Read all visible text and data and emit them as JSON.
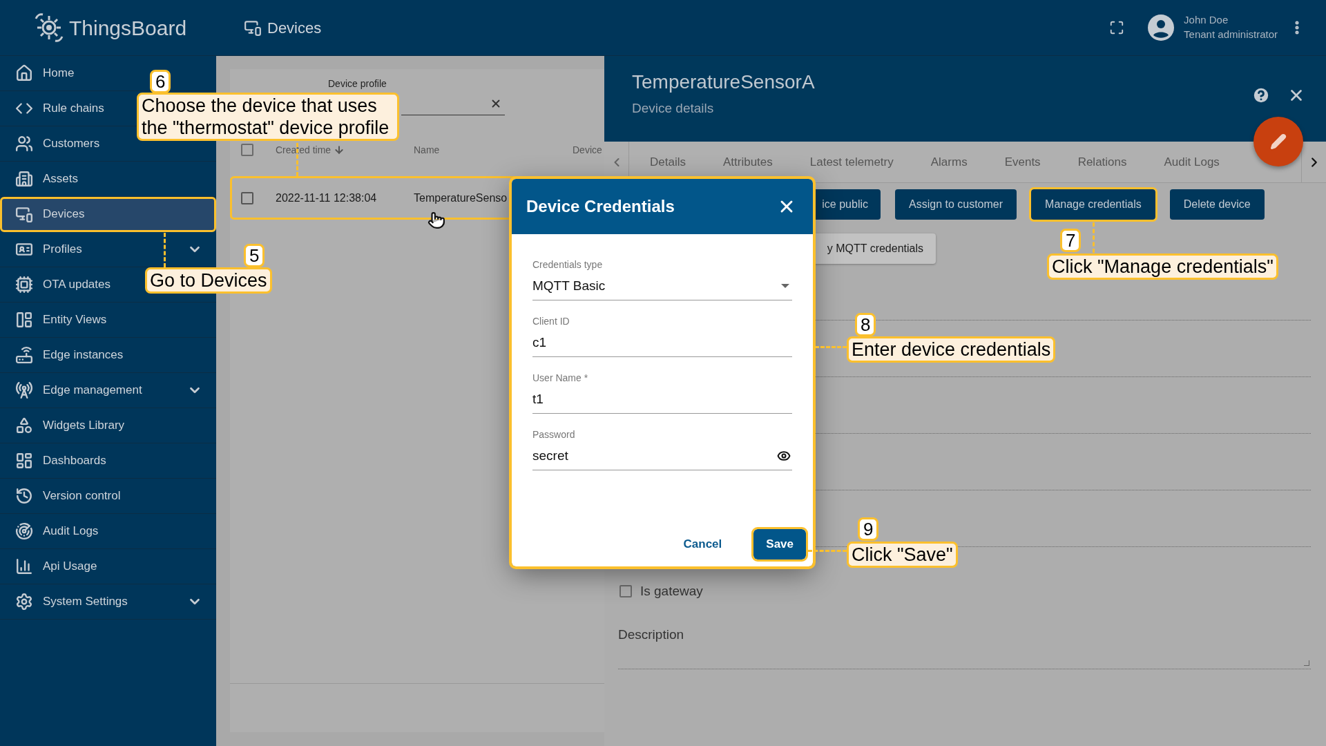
{
  "app": {
    "brand": "ThingsBoard"
  },
  "toolbar": {
    "title": "Devices",
    "user": {
      "name": "John Doe",
      "role": "Tenant administrator"
    }
  },
  "sidebar": {
    "items": [
      {
        "label": "Home",
        "selected": false,
        "highlighted": false,
        "expandable": false
      },
      {
        "label": "Rule chains",
        "selected": false,
        "highlighted": false,
        "expandable": false
      },
      {
        "label": "Customers",
        "selected": false,
        "highlighted": false,
        "expandable": false
      },
      {
        "label": "Assets",
        "selected": false,
        "highlighted": false,
        "expandable": false
      },
      {
        "label": "Devices",
        "selected": true,
        "highlighted": true,
        "expandable": false
      },
      {
        "label": "Profiles",
        "selected": false,
        "highlighted": false,
        "expandable": true
      },
      {
        "label": "OTA updates",
        "selected": false,
        "highlighted": false,
        "expandable": false
      },
      {
        "label": "Entity Views",
        "selected": false,
        "highlighted": false,
        "expandable": false
      },
      {
        "label": "Edge instances",
        "selected": false,
        "highlighted": false,
        "expandable": false
      },
      {
        "label": "Edge management",
        "selected": false,
        "highlighted": false,
        "expandable": true
      },
      {
        "label": "Widgets Library",
        "selected": false,
        "highlighted": false,
        "expandable": false
      },
      {
        "label": "Dashboards",
        "selected": false,
        "highlighted": false,
        "expandable": false
      },
      {
        "label": "Version control",
        "selected": false,
        "highlighted": false,
        "expandable": false
      },
      {
        "label": "Audit Logs",
        "selected": false,
        "highlighted": false,
        "expandable": false
      },
      {
        "label": "Api Usage",
        "selected": false,
        "highlighted": false,
        "expandable": false
      },
      {
        "label": "System Settings",
        "selected": false,
        "highlighted": false,
        "expandable": true
      }
    ]
  },
  "device_list": {
    "filter": {
      "label": "Device profile"
    },
    "all_selected": false,
    "columns": [
      {
        "label": "Created time",
        "sorted": true
      },
      {
        "label": "Name",
        "sorted": false
      },
      {
        "label": "Device",
        "sorted": false
      }
    ],
    "rows": [
      {
        "created_time": "2022-11-11 12:38:04",
        "name": "TemperatureSenso",
        "checked": false,
        "highlighted": true
      }
    ]
  },
  "details": {
    "title": "TemperatureSensorA",
    "subtitle": "Device details",
    "tabs": [
      "Details",
      "Attributes",
      "Latest telemetry",
      "Alarms",
      "Events",
      "Relations",
      "Audit Logs"
    ],
    "actions": [
      {
        "label": "ice public",
        "kind": "primary",
        "highlighted": false
      },
      {
        "label": "Assign to customer",
        "kind": "primary",
        "highlighted": false
      },
      {
        "label": "Manage credentials",
        "kind": "primary",
        "highlighted": true
      },
      {
        "label": "Delete device",
        "kind": "primary",
        "highlighted": false
      },
      {
        "label": "y MQTT credentials",
        "kind": "secondary",
        "highlighted": false
      }
    ],
    "is_gateway": {
      "label": "Is gateway",
      "checked": false
    },
    "description": {
      "label": "Description"
    }
  },
  "dialog": {
    "title": "Device Credentials",
    "highlighted": true,
    "fields": [
      {
        "label": "Credentials type",
        "value": "MQTT Basic",
        "kind": "select"
      },
      {
        "label": "Client ID",
        "value": "c1",
        "kind": "text"
      },
      {
        "label": "User Name *",
        "value": "t1",
        "kind": "text"
      },
      {
        "label": "Password",
        "value": "secret",
        "kind": "password"
      }
    ],
    "buttons": [
      {
        "label": "Cancel",
        "kind": "text",
        "highlighted": false
      },
      {
        "label": "Save",
        "kind": "primary",
        "highlighted": true
      }
    ]
  },
  "callouts": [
    {
      "number": "6",
      "text": "Choose the device that uses the \"thermostat\" device profile"
    },
    {
      "number": "5",
      "text": "Go to Devices"
    },
    {
      "number": "7",
      "text": "Click \"Manage credentials\""
    },
    {
      "number": "8",
      "text": "Enter device credentials"
    },
    {
      "number": "9",
      "text": "Click \"Save\""
    }
  ]
}
